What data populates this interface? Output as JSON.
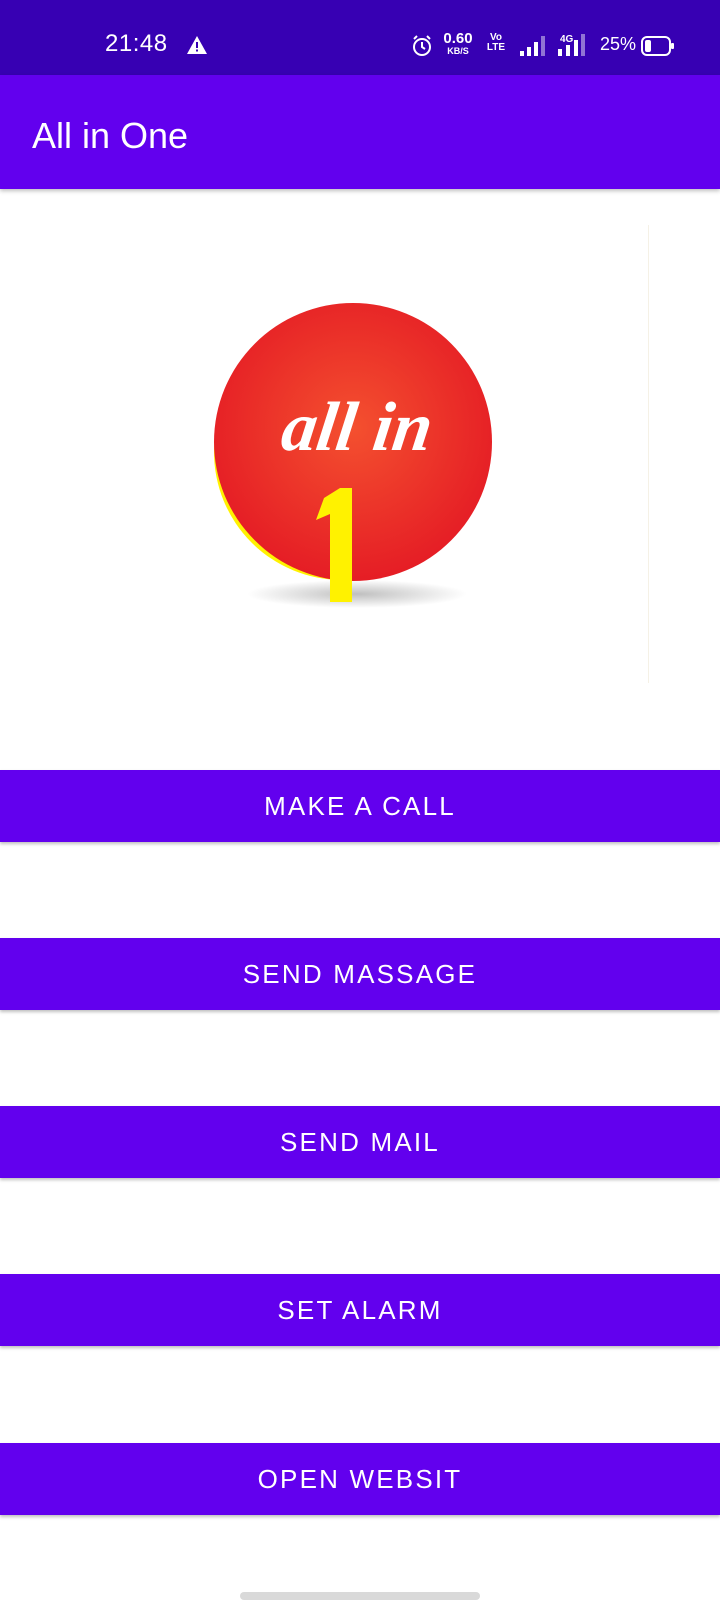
{
  "status_bar": {
    "time": "21:48",
    "speed_value": "0.60",
    "speed_unit": "KB/S",
    "volte_top": "Vo",
    "volte_bottom": "LTE",
    "network": "4G",
    "battery": "25%",
    "icons": [
      "warning-icon",
      "alarm-icon",
      "signal-icon",
      "signal-4g-icon",
      "battery-icon"
    ],
    "color": "#3700b3"
  },
  "app_bar": {
    "title": "All in One",
    "color": "#6200ee"
  },
  "logo": {
    "text_top": "all in",
    "text_number": "1",
    "circle_color": "#ee2a24",
    "accent_color": "#fff200"
  },
  "buttons": {
    "call": "MAKE A CALL",
    "message": "SEND MASSAGE",
    "mail": "SEND MAIL",
    "alarm": "SET ALARM",
    "website": "OPEN WEBSIT"
  }
}
